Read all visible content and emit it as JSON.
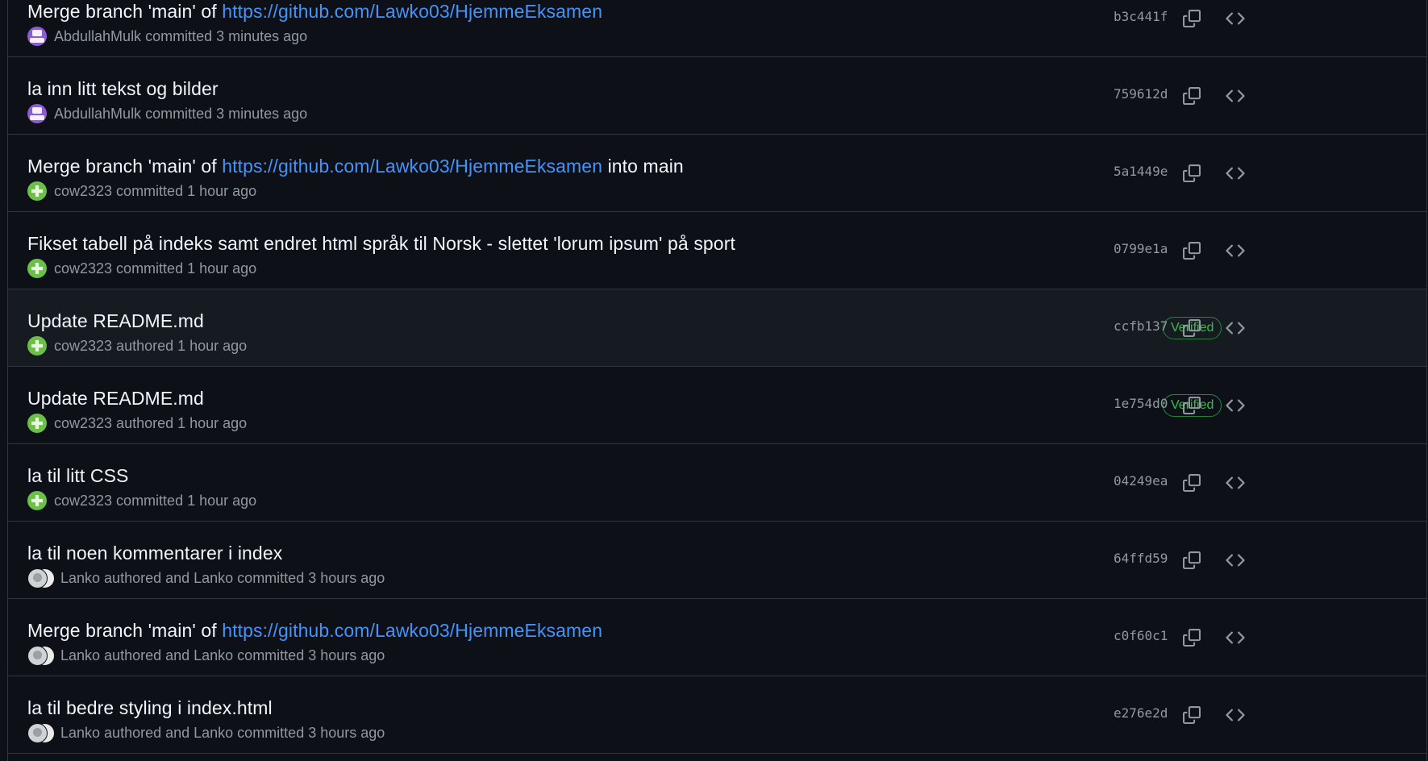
{
  "commits": [
    {
      "message_parts": [
        {
          "text": "Merge branch 'main' of ",
          "link": false
        },
        {
          "text": "https://github.com/Lawko03/HjemmeEksamen",
          "link": true
        }
      ],
      "avatar": "purple",
      "meta": "AbdullahMulk committed 3 minutes ago",
      "verified": "",
      "sha": "b3c441f"
    },
    {
      "message_parts": [
        {
          "text": "la inn litt tekst og bilder",
          "link": false
        }
      ],
      "avatar": "purple",
      "meta": "AbdullahMulk committed 3 minutes ago",
      "verified": "",
      "sha": "759612d"
    },
    {
      "message_parts": [
        {
          "text": "Merge branch 'main' of ",
          "link": false
        },
        {
          "text": "https://github.com/Lawko03/HjemmeEksamen",
          "link": true
        },
        {
          "text": " into main",
          "link": false
        }
      ],
      "avatar": "green",
      "meta": "cow2323 committed 1 hour ago",
      "verified": "",
      "sha": "5a1449e"
    },
    {
      "message_parts": [
        {
          "text": "Fikset tabell på indeks samt endret html språk til Norsk - slettet 'lorum ipsum' på sport",
          "link": false
        }
      ],
      "avatar": "green",
      "meta": "cow2323 committed 1 hour ago",
      "verified": "",
      "sha": "0799e1a"
    },
    {
      "message_parts": [
        {
          "text": "Update README.md",
          "link": false
        }
      ],
      "avatar": "green",
      "meta": "cow2323 authored 1 hour ago",
      "verified": "Verified",
      "sha": "ccfb137",
      "hover": true
    },
    {
      "message_parts": [
        {
          "text": "Update README.md",
          "link": false
        }
      ],
      "avatar": "green",
      "meta": "cow2323 authored 1 hour ago",
      "verified": "Verified",
      "sha": "1e754d0"
    },
    {
      "message_parts": [
        {
          "text": "la til litt CSS",
          "link": false
        }
      ],
      "avatar": "green",
      "meta": "cow2323 committed 1 hour ago",
      "verified": "",
      "sha": "04249ea"
    },
    {
      "message_parts": [
        {
          "text": "la til noen kommentarer i index",
          "link": false
        }
      ],
      "avatar": "pair",
      "meta": "Lanko authored and Lanko committed 3 hours ago",
      "verified": "",
      "sha": "64ffd59"
    },
    {
      "message_parts": [
        {
          "text": "Merge branch 'main' of ",
          "link": false
        },
        {
          "text": "https://github.com/Lawko03/HjemmeEksamen",
          "link": true
        }
      ],
      "avatar": "pair",
      "meta": "Lanko authored and Lanko committed 3 hours ago",
      "verified": "",
      "sha": "c0f60c1"
    },
    {
      "message_parts": [
        {
          "text": "la til bedre styling i index.html",
          "link": false
        }
      ],
      "avatar": "pair",
      "meta": "Lanko authored and Lanko committed 3 hours ago",
      "verified": "",
      "sha": "e276e2d"
    }
  ],
  "icons": {
    "copy": "copy-icon",
    "browse": "code-icon"
  },
  "colors": {
    "background": "#0d1117",
    "link": "#4493f8",
    "verified": "#3fb950",
    "muted": "#9198a1"
  }
}
